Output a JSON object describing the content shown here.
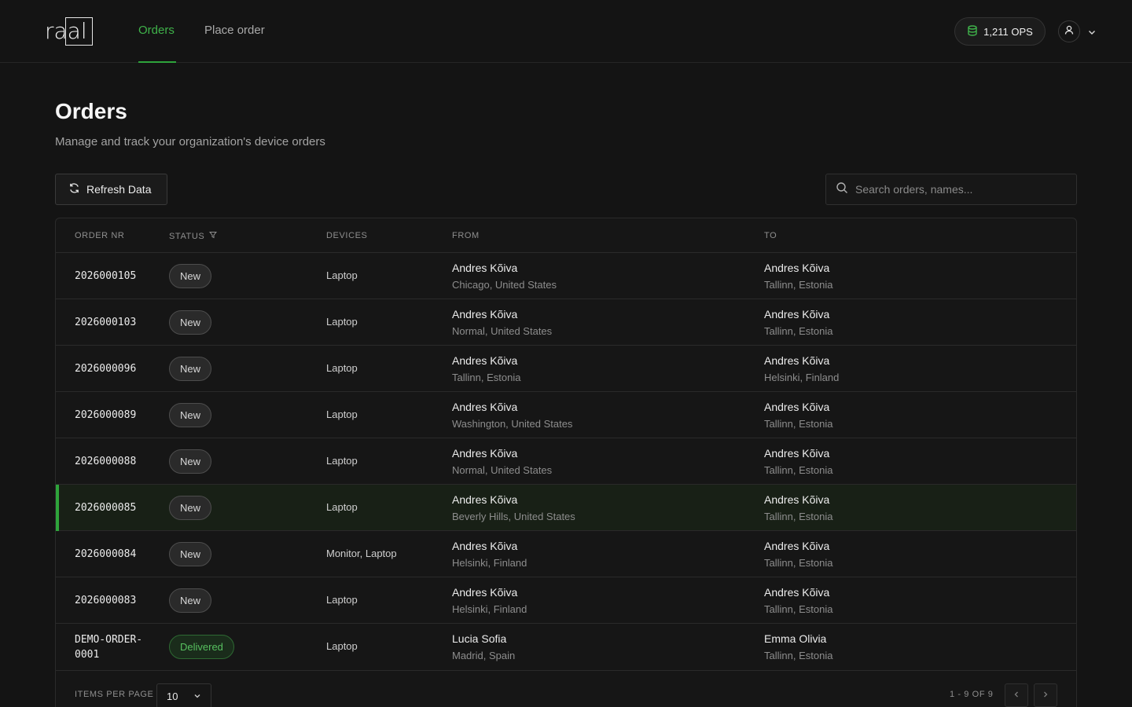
{
  "app": {
    "logo": "raal"
  },
  "nav": {
    "tabs": [
      {
        "label": "Orders"
      },
      {
        "label": "Place order"
      }
    ]
  },
  "header": {
    "credits": "1,211 OPS"
  },
  "page": {
    "title": "Orders",
    "subtitle": "Manage and track your organization's device orders",
    "refresh_label": "Refresh Data",
    "search_placeholder": "Search orders, names..."
  },
  "table": {
    "columns": [
      "ORDER NR",
      "STATUS",
      "DEVICES",
      "FROM",
      "TO"
    ],
    "rows": [
      {
        "order": "2026000105",
        "status": "New",
        "devices": "Laptop",
        "from_name": "Andres Kõiva",
        "from_place": "Chicago, United States",
        "to_name": "Andres Kõiva",
        "to_place": "Tallinn, Estonia"
      },
      {
        "order": "2026000103",
        "status": "New",
        "devices": "Laptop",
        "from_name": "Andres Kõiva",
        "from_place": "Normal, United States",
        "to_name": "Andres Kõiva",
        "to_place": "Tallinn, Estonia"
      },
      {
        "order": "2026000096",
        "status": "New",
        "devices": "Laptop",
        "from_name": "Andres Kõiva",
        "from_place": "Tallinn, Estonia",
        "to_name": "Andres Kõiva",
        "to_place": "Helsinki, Finland"
      },
      {
        "order": "2026000089",
        "status": "New",
        "devices": "Laptop",
        "from_name": "Andres Kõiva",
        "from_place": "Washington, United States",
        "to_name": "Andres Kõiva",
        "to_place": "Tallinn, Estonia"
      },
      {
        "order": "2026000088",
        "status": "New",
        "devices": "Laptop",
        "from_name": "Andres Kõiva",
        "from_place": "Normal, United States",
        "to_name": "Andres Kõiva",
        "to_place": "Tallinn, Estonia"
      },
      {
        "order": "2026000085",
        "status": "New",
        "devices": "Laptop",
        "from_name": "Andres Kõiva",
        "from_place": "Beverly Hills, United States",
        "to_name": "Andres Kõiva",
        "to_place": "Tallinn, Estonia"
      },
      {
        "order": "2026000084",
        "status": "New",
        "devices": "Monitor, Laptop",
        "from_name": "Andres Kõiva",
        "from_place": "Helsinki, Finland",
        "to_name": "Andres Kõiva",
        "to_place": "Tallinn, Estonia"
      },
      {
        "order": "2026000083",
        "status": "New",
        "devices": "Laptop",
        "from_name": "Andres Kõiva",
        "from_place": "Helsinki, Finland",
        "to_name": "Andres Kõiva",
        "to_place": "Tallinn, Estonia"
      },
      {
        "order": "DEMO-ORDER-0001",
        "order_line1": "DEMO-ORDER-",
        "order_line2": "0001",
        "status": "Delivered",
        "devices": "Laptop",
        "from_name": "Lucia Sofia",
        "from_place": "Madrid, Spain",
        "to_name": "Emma Olivia",
        "to_place": "Tallinn, Estonia"
      }
    ]
  },
  "pagination": {
    "items_per_page_label": "ITEMS PER PAGE",
    "items_per_page_value": "10",
    "range": "1 - 9 OF 9"
  },
  "colors": {
    "accent": "#2ea43b",
    "background": "#141414"
  },
  "icons": [
    "database-icon",
    "user-icon",
    "chevron-down-icon",
    "refresh-icon",
    "search-icon",
    "filter-icon",
    "chevron-left-icon",
    "chevron-right-icon"
  ]
}
